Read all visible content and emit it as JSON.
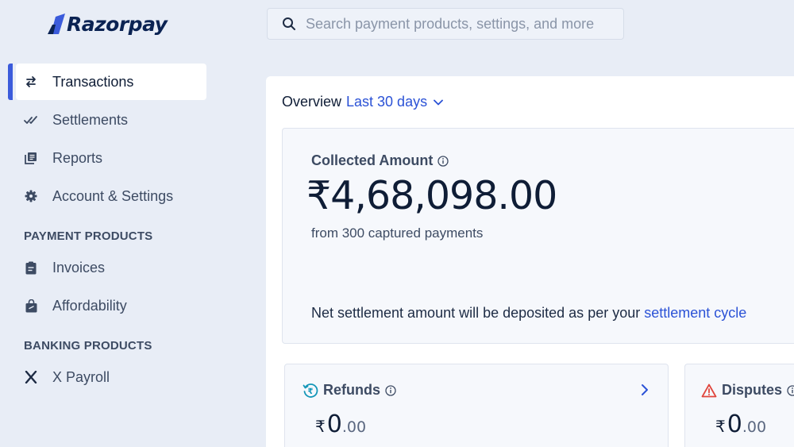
{
  "brand": {
    "name": "Razorpay",
    "accent": "#3b5bdb",
    "link": "#2b52d6"
  },
  "search": {
    "placeholder": "Search payment products, settings, and more",
    "icon": "search-icon"
  },
  "sidebar": {
    "items": [
      {
        "label": "Transactions",
        "icon": "transfer-icon",
        "active": true
      },
      {
        "label": "Settlements",
        "icon": "double-check-icon"
      },
      {
        "label": "Reports",
        "icon": "reports-icon"
      },
      {
        "label": "Account & Settings",
        "icon": "gear-icon"
      }
    ],
    "payment_products": {
      "title": "PAYMENT PRODUCTS",
      "items": [
        {
          "label": "Invoices",
          "icon": "clipboard-icon"
        },
        {
          "label": "Affordability",
          "icon": "bag-icon"
        }
      ]
    },
    "banking_products": {
      "title": "BANKING PRODUCTS",
      "items": [
        {
          "label": "X Payroll",
          "icon": "x-logo-icon"
        }
      ]
    }
  },
  "overview": {
    "label": "Overview",
    "range": "Last 30 days"
  },
  "collected": {
    "title": "Collected Amount",
    "amount": "₹4,68,098.00",
    "subtext": "from 300 captured payments",
    "note_prefix": "Net settlement amount will be deposited as per your ",
    "note_link": "settlement cycle"
  },
  "refunds": {
    "title": "Refunds",
    "currency": "₹",
    "integer": "0",
    "decimal": ".00"
  },
  "disputes": {
    "title": "Disputes",
    "currency": "₹",
    "integer": "0",
    "decimal": ".00"
  }
}
